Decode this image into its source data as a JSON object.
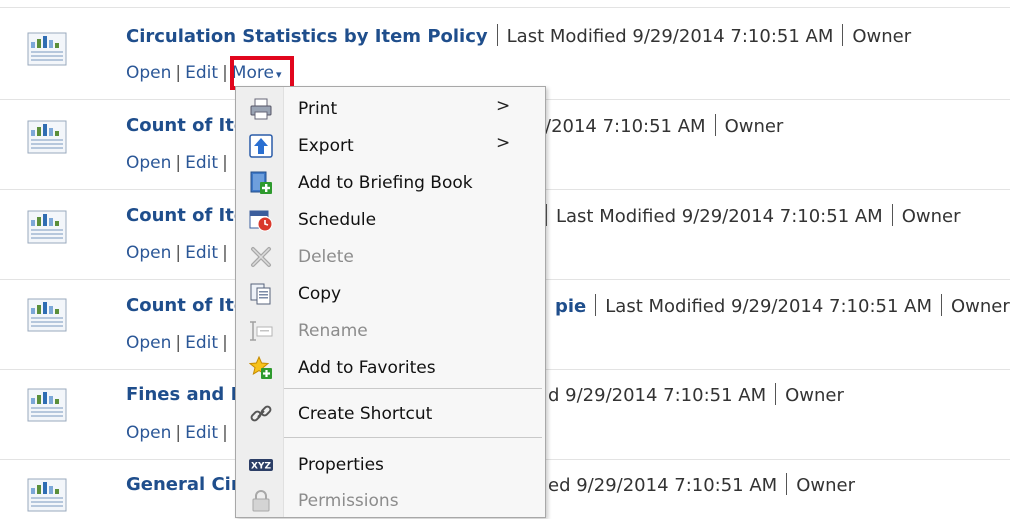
{
  "rows": [
    {
      "title": "Circulation Statistics by Item Policy",
      "modified": "Last Modified 9/29/2014 7:10:51 AM",
      "owner": "Owner"
    },
    {
      "title": "Count of Ite",
      "modified": "/2014 7:10:51 AM",
      "owner": "Owner"
    },
    {
      "title": "Count of Ite",
      "modified": "Last Modified 9/29/2014 7:10:51 AM",
      "owner": "Owner"
    },
    {
      "title": "Count of Ite",
      "title_tail": "pie",
      "modified": "Last Modified 9/29/2014 7:10:51 AM",
      "owner": "Owner"
    },
    {
      "title": "Fines and F",
      "modified": "d 9/29/2014 7:10:51 AM",
      "owner": "Owner"
    },
    {
      "title": "General Cir",
      "modified": "ed 9/29/2014 7:10:51 AM",
      "owner": "Owner"
    }
  ],
  "links": {
    "open": "Open",
    "edit": "Edit",
    "more": "More",
    "sep": "|"
  },
  "context_menu": {
    "items": [
      {
        "label": "Print",
        "icon": "printer-icon",
        "submenu": true,
        "enabled": true
      },
      {
        "label": "Export",
        "icon": "export-icon",
        "submenu": true,
        "enabled": true
      },
      {
        "label": "Add to Briefing Book",
        "icon": "briefing-book-add-icon",
        "enabled": true
      },
      {
        "label": "Schedule",
        "icon": "schedule-icon",
        "enabled": true
      },
      {
        "label": "Delete",
        "icon": "delete-icon",
        "enabled": false
      },
      {
        "label": "Copy",
        "icon": "copy-icon",
        "enabled": true
      },
      {
        "label": "Rename",
        "icon": "rename-icon",
        "enabled": false
      },
      {
        "label": "Add to Favorites",
        "icon": "favorites-add-icon",
        "enabled": true
      },
      {
        "label": "Create Shortcut",
        "icon": "shortcut-link-icon",
        "enabled": true
      },
      {
        "label": "Properties",
        "icon": "properties-icon",
        "enabled": true
      },
      {
        "label": "Permissions",
        "icon": "permissions-lock-icon",
        "enabled": false
      }
    ],
    "submenu_arrow": ">"
  },
  "colors": {
    "title": "#1f4e8c",
    "link": "#2b5797",
    "highlight": "#e1061d",
    "disabled": "#8c8c8c"
  }
}
